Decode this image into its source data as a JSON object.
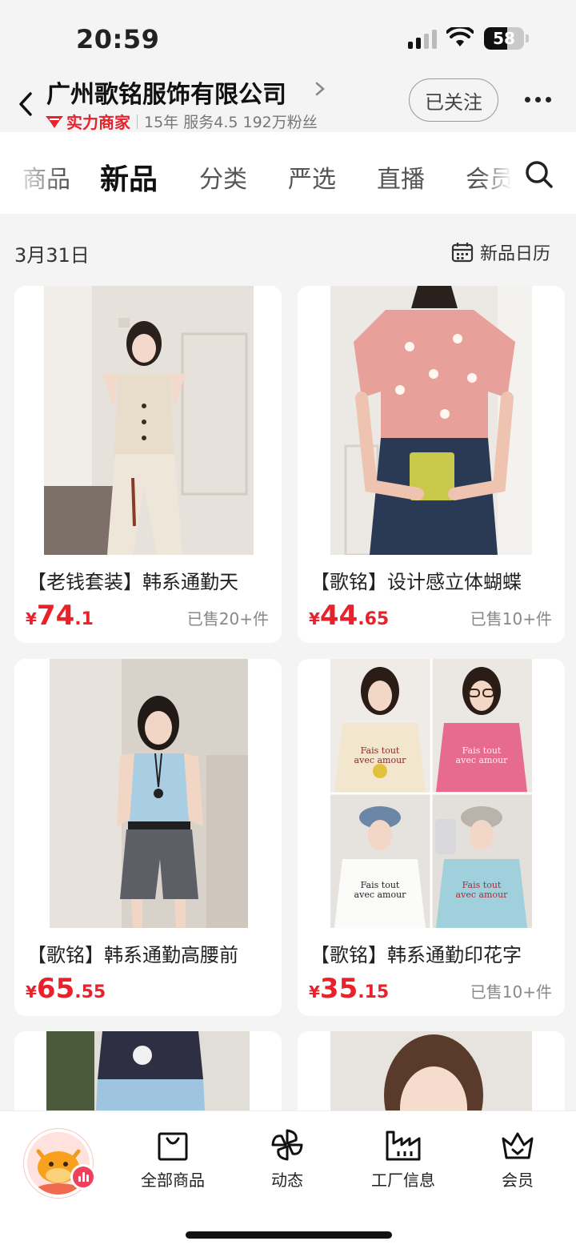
{
  "status_bar": {
    "time": "20:59",
    "battery": "58",
    "battery_level": 0.58
  },
  "header": {
    "shop_name": "广州歌铭服饰有限公司",
    "badge": "实力商家",
    "years": "15年",
    "service": "服务4.5",
    "fans": "192万粉丝",
    "follow_label": "已关注"
  },
  "tabs": [
    {
      "label": "商品",
      "active": false
    },
    {
      "label": "新品",
      "active": true
    },
    {
      "label": "分类",
      "active": false
    },
    {
      "label": "严选",
      "active": false
    },
    {
      "label": "直播",
      "active": false
    },
    {
      "label": "会员",
      "active": false
    }
  ],
  "section": {
    "date": "3月31日",
    "calendar_label": "新品日历"
  },
  "products": [
    {
      "title": "【老钱套装】韩系通勤天",
      "currency": "¥",
      "price_int": "74",
      "price_dec": ".1",
      "sold": "已售20+件"
    },
    {
      "title": "【歌铭】设计感立体蝴蝶",
      "currency": "¥",
      "price_int": "44",
      "price_dec": ".65",
      "sold": "已售10+件"
    },
    {
      "title": "【歌铭】韩系通勤高腰前",
      "currency": "¥",
      "price_int": "65",
      "price_dec": ".55",
      "sold": ""
    },
    {
      "title": "【歌铭】韩系通勤印花字",
      "currency": "¥",
      "price_int": "35",
      "price_dec": ".15",
      "sold": "已售10+件"
    }
  ],
  "shirt_print": {
    "line1": "Fais tout",
    "line2": "avec amour"
  },
  "bottom_nav": [
    {
      "label": "全部商品",
      "icon": "bag-icon"
    },
    {
      "label": "动态",
      "icon": "pinwheel-icon"
    },
    {
      "label": "工厂信息",
      "icon": "factory-icon"
    },
    {
      "label": "会员",
      "icon": "crown-icon"
    }
  ],
  "colors": {
    "accent_red": "#e8212b",
    "background": "#f4f4f4"
  }
}
